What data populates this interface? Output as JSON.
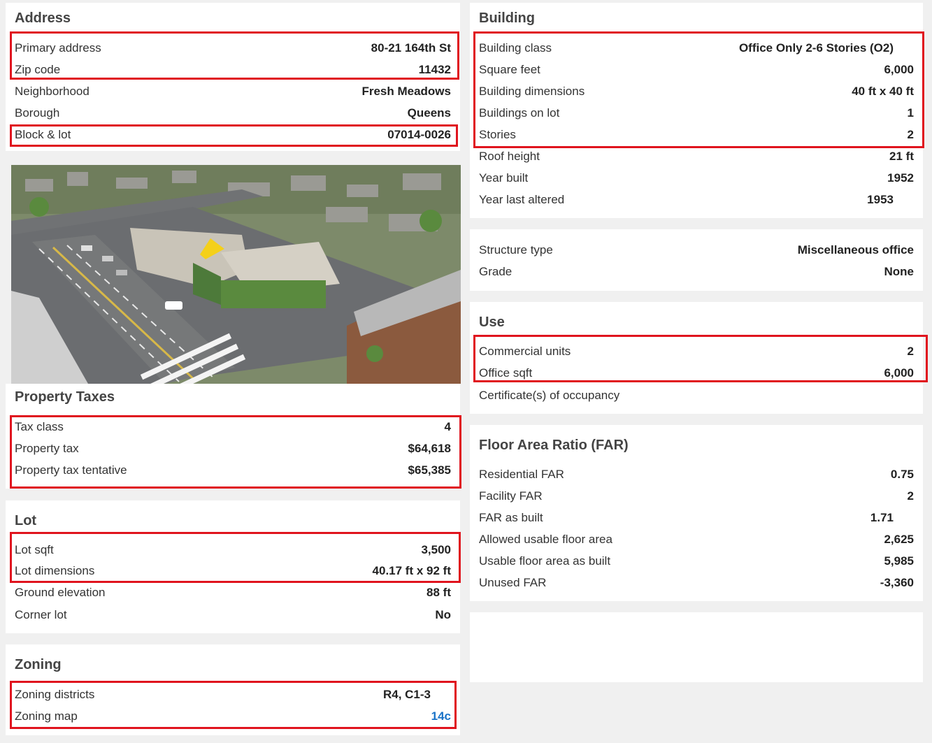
{
  "address": {
    "title": "Address",
    "rows": [
      {
        "label": "Primary address",
        "value": "80-21 164th St"
      },
      {
        "label": "Zip code",
        "value": "11432"
      },
      {
        "label": "Neighborhood",
        "value": "Fresh Meadows"
      },
      {
        "label": "Borough",
        "value": "Queens"
      },
      {
        "label": "Block & lot",
        "value": "07014-0026"
      }
    ]
  },
  "photo": {
    "description_icon": "aerial-photo"
  },
  "property_taxes": {
    "title": "Property Taxes",
    "rows": [
      {
        "label": "Tax class",
        "value": "4"
      },
      {
        "label": "Property tax",
        "value": "$64,618"
      },
      {
        "label": "Property tax tentative",
        "value": "$65,385"
      }
    ]
  },
  "lot": {
    "title": "Lot",
    "rows": [
      {
        "label": "Lot sqft",
        "value": "3,500"
      },
      {
        "label": "Lot dimensions",
        "value": "40.17 ft x 92 ft"
      },
      {
        "label": "Ground elevation",
        "value": "88 ft"
      },
      {
        "label": "Corner lot",
        "value": "No"
      }
    ]
  },
  "zoning": {
    "title": "Zoning",
    "rows": [
      {
        "label": "Zoning districts",
        "value": "R4, C1-3"
      },
      {
        "label": "Zoning map",
        "value": "14c"
      }
    ]
  },
  "building": {
    "title": "Building",
    "rows": [
      {
        "label": "Building class",
        "value": "Office Only 2-6 Stories (O2)"
      },
      {
        "label": "Square feet",
        "value": "6,000"
      },
      {
        "label": "Building dimensions",
        "value": "40 ft x 40 ft"
      },
      {
        "label": "Buildings on lot",
        "value": "1"
      },
      {
        "label": "Stories",
        "value": "2"
      },
      {
        "label": "Roof height",
        "value": "21 ft"
      },
      {
        "label": "Year built",
        "value": "1952"
      },
      {
        "label": "Year last altered",
        "value": "1953"
      }
    ]
  },
  "structure": {
    "rows": [
      {
        "label": "Structure type",
        "value": "Miscellaneous office"
      },
      {
        "label": "Grade",
        "value": "None"
      }
    ]
  },
  "use": {
    "title": "Use",
    "rows": [
      {
        "label": "Commercial units",
        "value": "2"
      },
      {
        "label": "Office sqft",
        "value": "6,000"
      },
      {
        "label": "Certificate(s) of occupancy",
        "value": ""
      }
    ]
  },
  "far": {
    "title": "Floor Area Ratio (FAR)",
    "rows": [
      {
        "label": "Residential FAR",
        "value": "0.75"
      },
      {
        "label": "Facility FAR",
        "value": "2"
      },
      {
        "label": "FAR as built",
        "value": "1.71"
      },
      {
        "label": "Allowed usable floor area",
        "value": "2,625"
      },
      {
        "label": "Usable floor area as built",
        "value": "5,985"
      },
      {
        "label": "Unused FAR",
        "value": "-3,360"
      }
    ]
  },
  "colors": {
    "highlight": "#e0141e",
    "link": "#1a73c8"
  }
}
